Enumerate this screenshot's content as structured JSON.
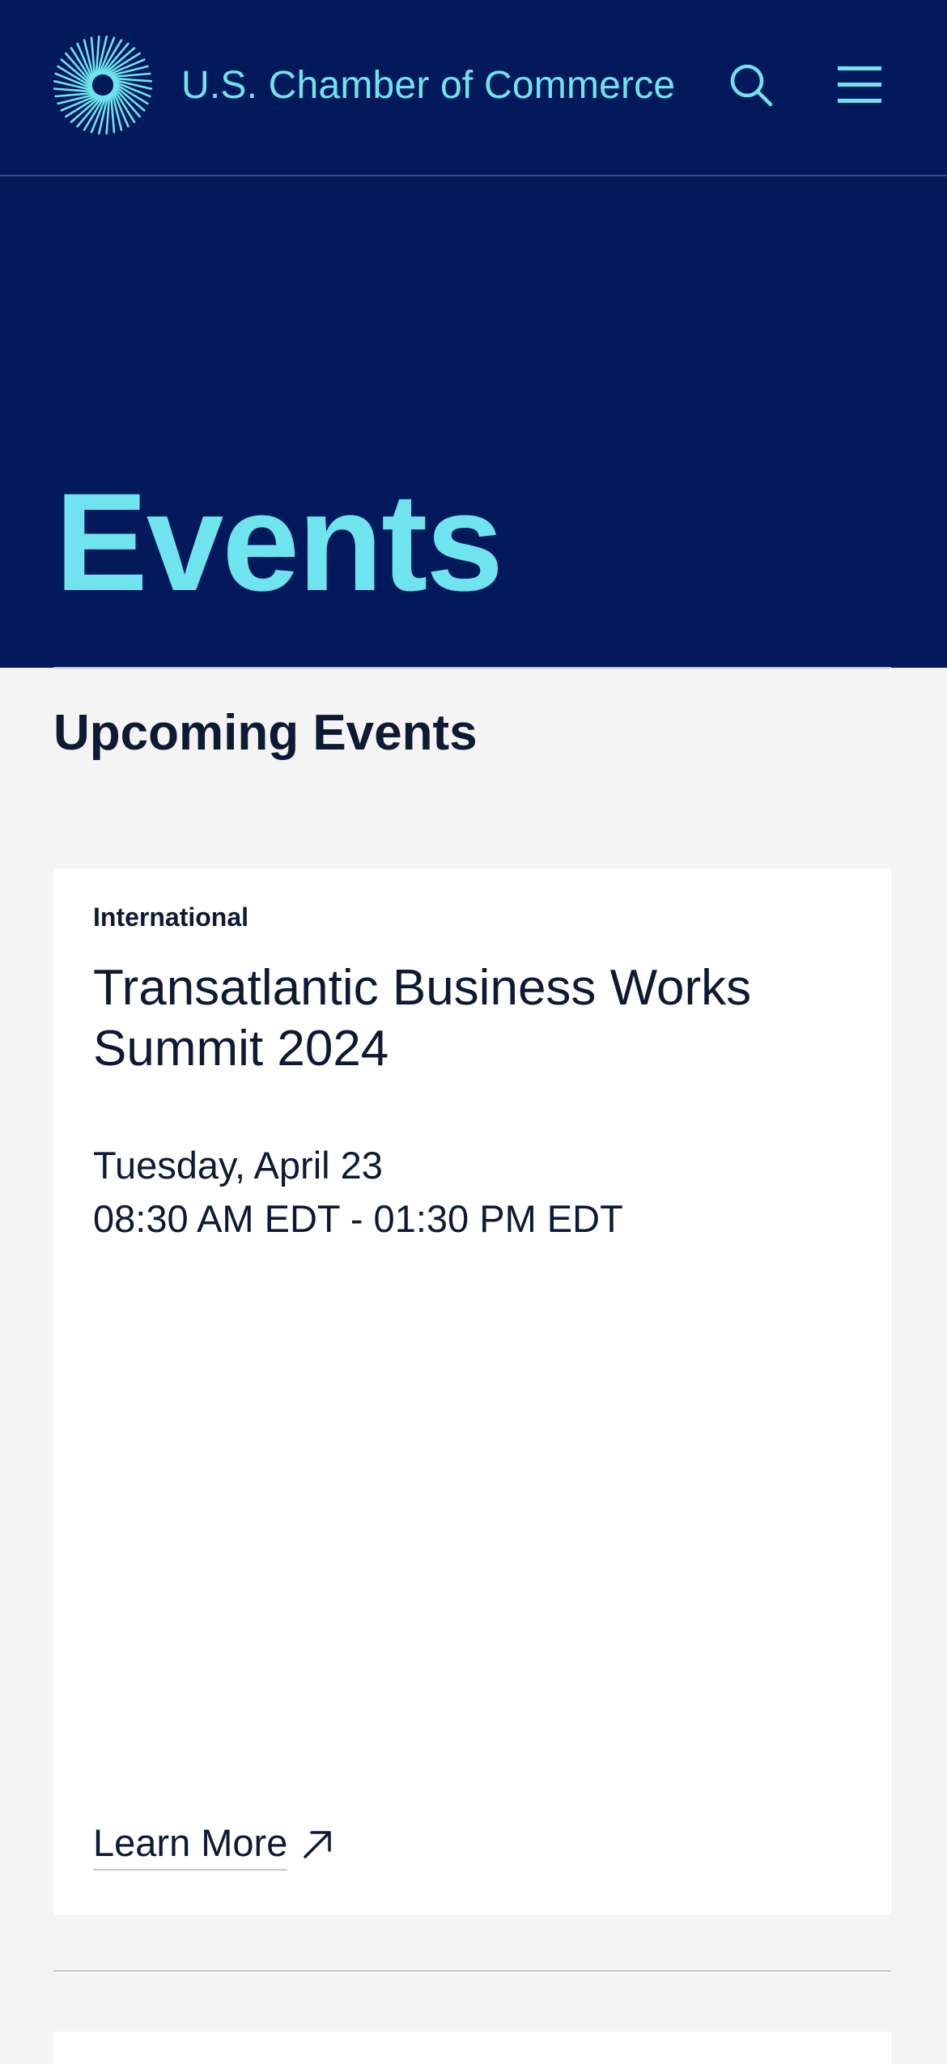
{
  "header": {
    "brand_name": "U.S. Chamber of Commerce",
    "logo_icon": "sunburst-logo-icon",
    "search_icon": "search-icon",
    "menu_icon": "hamburger-menu-icon"
  },
  "hero": {
    "title": "Events"
  },
  "main": {
    "section_heading": "Upcoming Events",
    "events": [
      {
        "category": "International",
        "title": "Transatlantic Business Works Summit 2024",
        "date": "Tuesday, April 23",
        "time": "08:30 AM EDT - 01:30 PM EDT",
        "link_label": "Learn More",
        "link_icon": "arrow-up-right-icon"
      }
    ]
  },
  "colors": {
    "navy": "#021a5b",
    "accent": "#6fe4ee",
    "text_dark": "#0e1a33",
    "page_bg": "#f4f4f4",
    "card_bg": "#ffffff"
  }
}
